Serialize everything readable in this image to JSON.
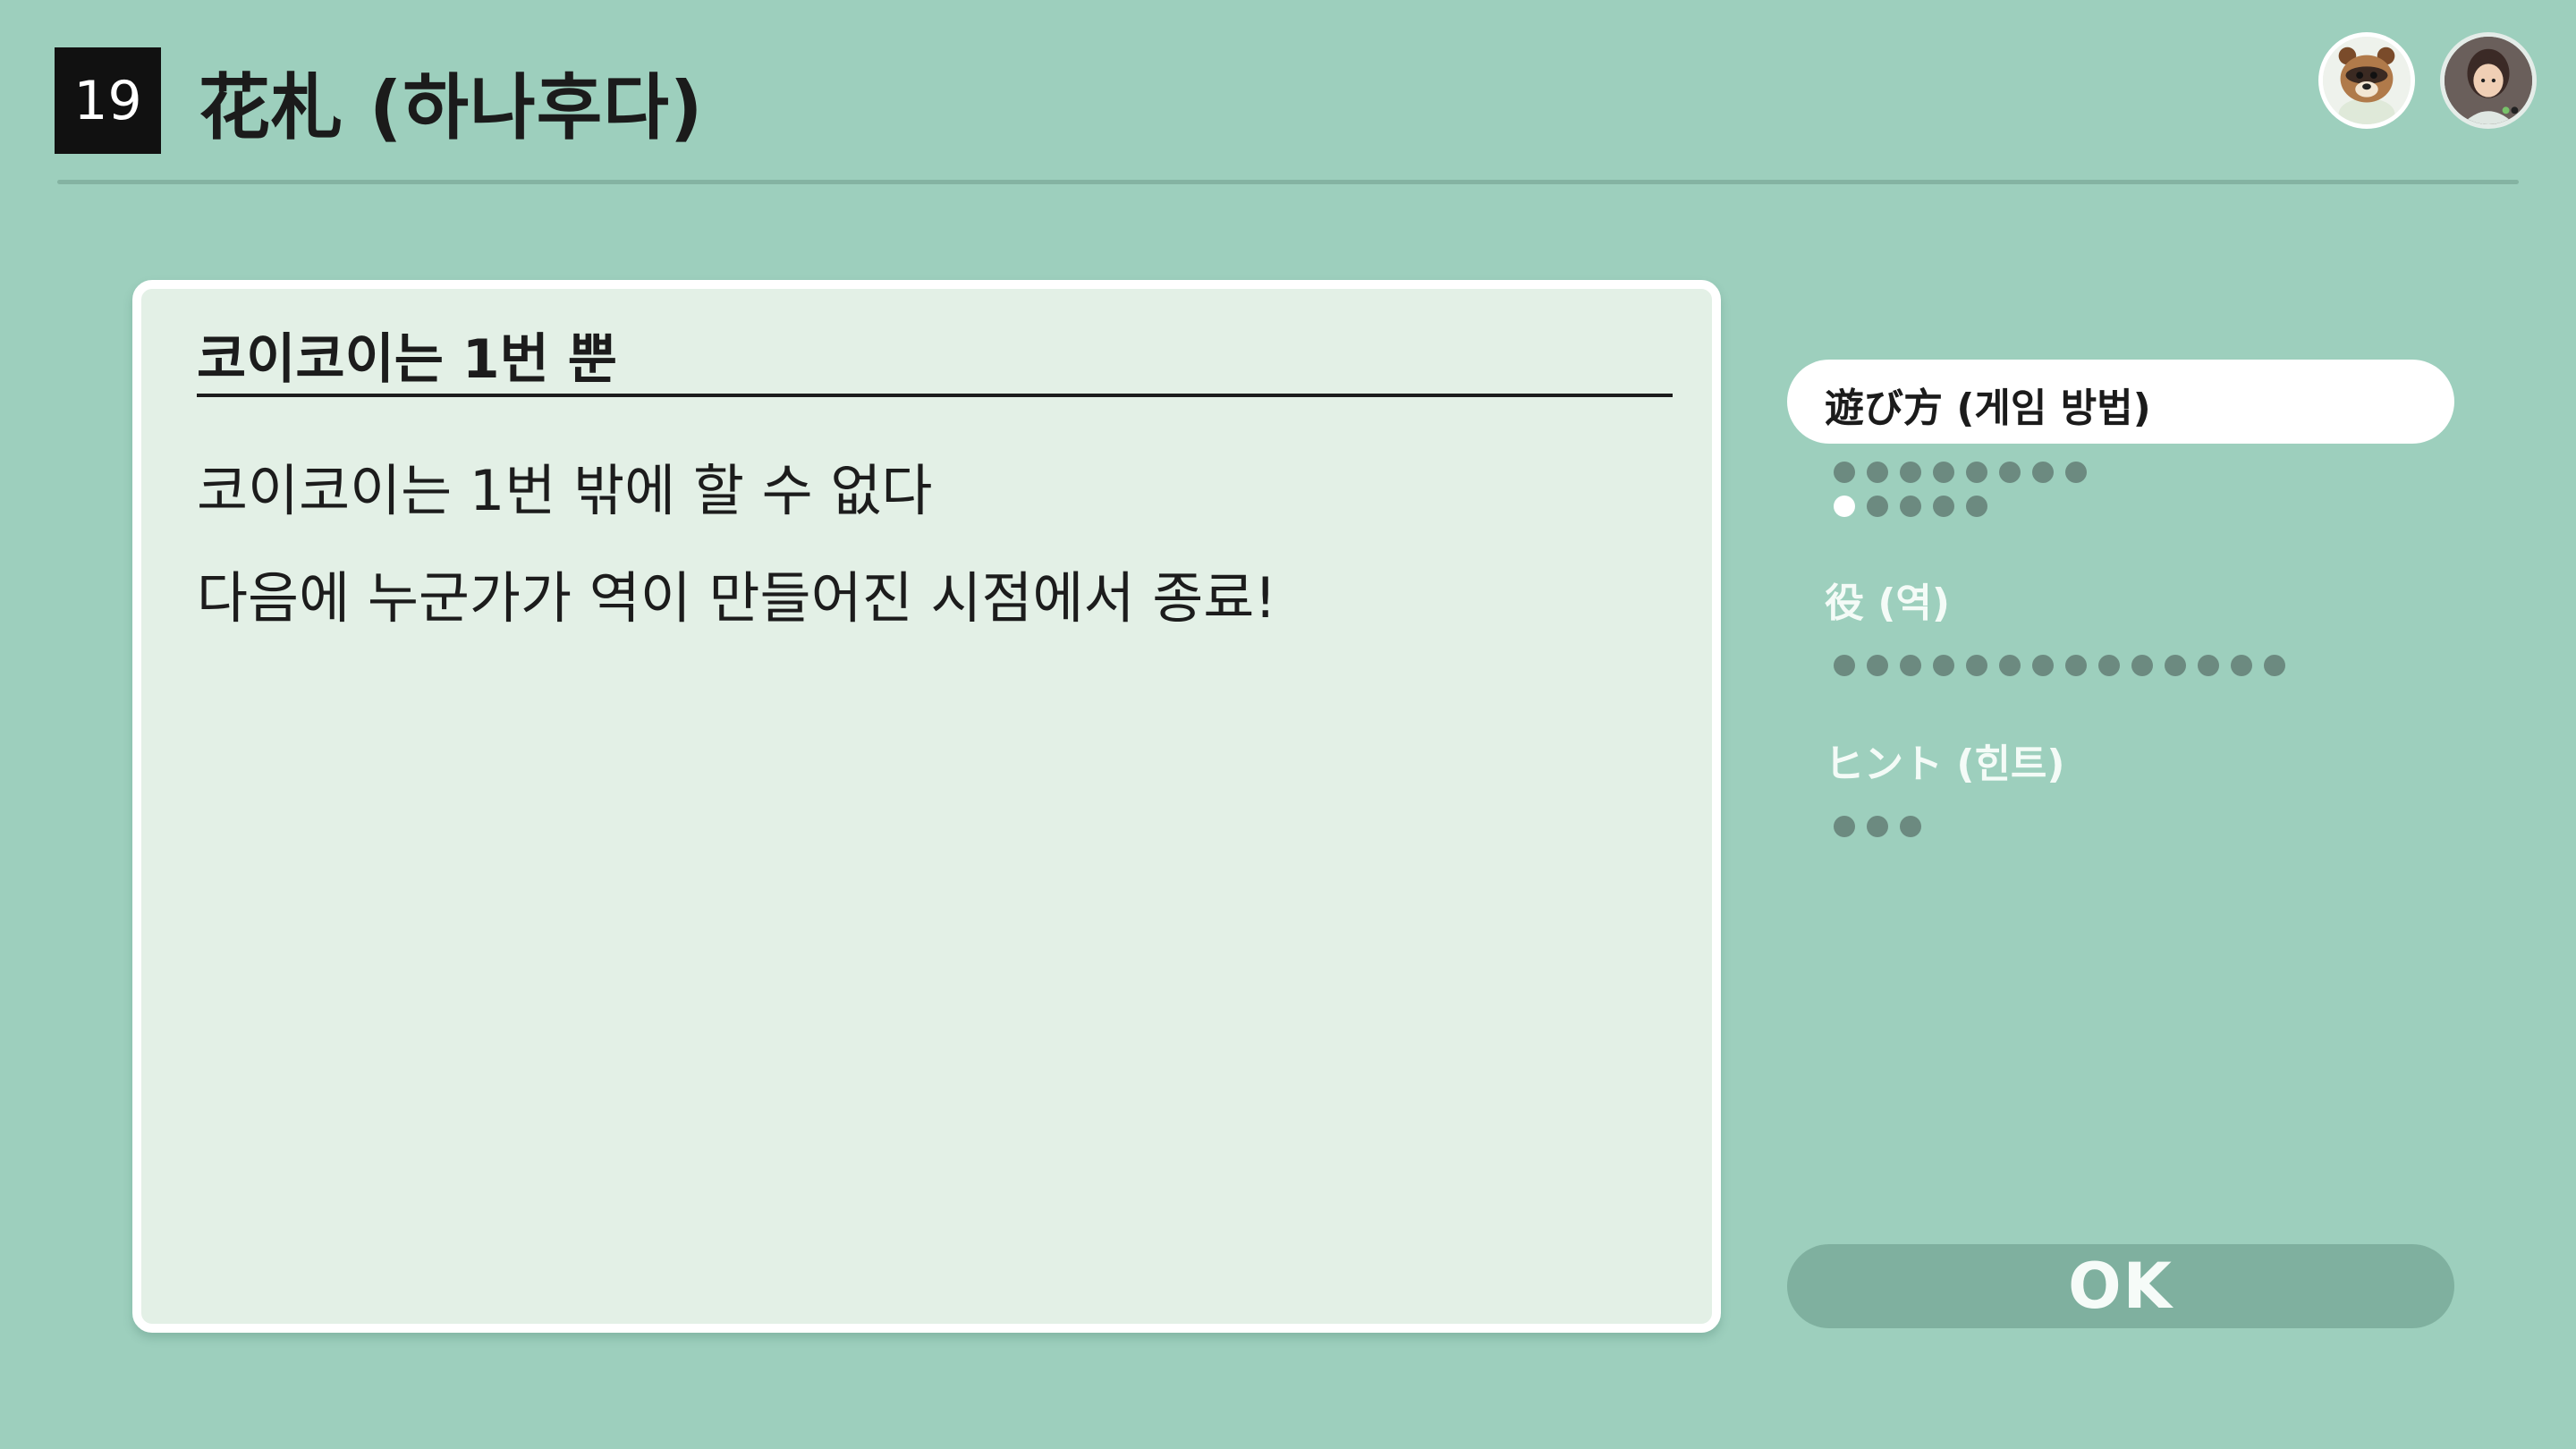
{
  "header": {
    "number": "19",
    "title": "花札 (하나후다)"
  },
  "avatars": [
    {
      "icon": "tom-nook-avatar-icon"
    },
    {
      "icon": "player-avatar-icon"
    }
  ],
  "panel": {
    "title": "코이코이는 1번 뿐",
    "lines": [
      "코이코이는 1번 밖에 할 수 없다",
      "다음에 누군가가 역이 만들어진 시점에서 종료!"
    ]
  },
  "sections": [
    {
      "label": "遊び方 (게임 방법)",
      "active": true,
      "pages_total": 13,
      "current_page": 9
    },
    {
      "label": "役 (역)",
      "active": false,
      "pages_total": 14,
      "current_page": null
    },
    {
      "label": "ヒント (힌트)",
      "active": false,
      "pages_total": 3,
      "current_page": null
    }
  ],
  "ok_button": {
    "label": "OK"
  },
  "colors": {
    "background": "#9dcfbd",
    "panel_fill": "#e3f0e6",
    "dot_inactive": "#6c8a80",
    "dot_current": "#ffffff",
    "ok_button": "#7fb09f"
  }
}
